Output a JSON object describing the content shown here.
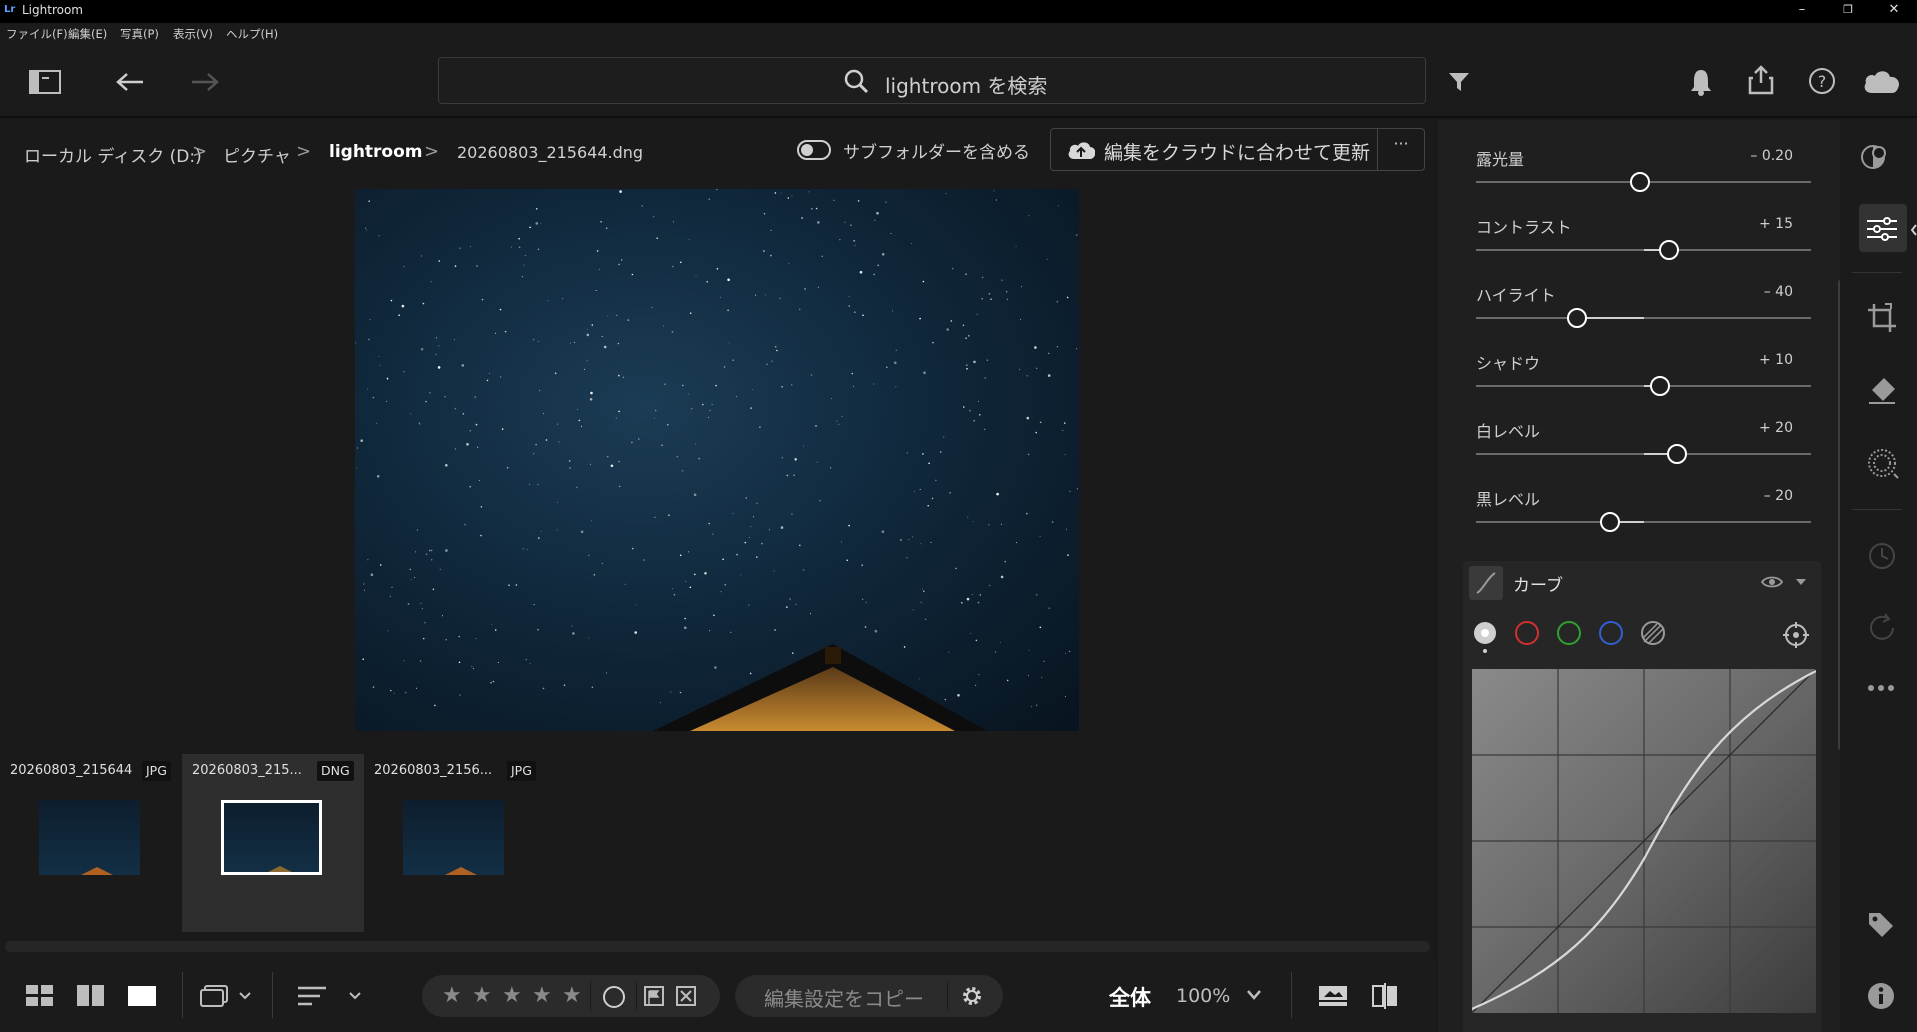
{
  "window": {
    "app_logo": "Lr",
    "title": "Lightroom",
    "minimize": "–",
    "restore": "❐",
    "close": "✕"
  },
  "menu": [
    "ファイル(F)",
    "編集(E)",
    "写真(P)",
    "表示(V)",
    "ヘルプ(H)"
  ],
  "search": {
    "placeholder": "lightroom を検索"
  },
  "breadcrumb": {
    "items": [
      "ローカル ディスク (D:)",
      "ピクチャ",
      "lightroom",
      "20260803_215644.dng"
    ],
    "separator": ">"
  },
  "subfolder_toggle": {
    "label": "サブフォルダーを含める",
    "on": false
  },
  "cloud_button": {
    "label": "編集をクラウドに合わせて更新",
    "more": "···"
  },
  "filmstrip": [
    {
      "name": "20260803_215644",
      "badge": "JPG",
      "selected": false
    },
    {
      "name": "20260803_215...",
      "badge": "DNG",
      "selected": true
    },
    {
      "name": "20260803_2156...",
      "badge": "JPG",
      "selected": false
    }
  ],
  "bottombar": {
    "stars": [
      "★",
      "★",
      "★",
      "★",
      "★"
    ],
    "copy_settings": "編集設定をコピー",
    "view_mode": "全体",
    "zoom": "100%"
  },
  "adjustments": [
    {
      "label": "露光量",
      "value": "– 0.20",
      "norm": 0.49
    },
    {
      "label": "コントラスト",
      "value": "+ 15",
      "norm": 0.575
    },
    {
      "label": "ハイライト",
      "value": "– 40",
      "norm": 0.3
    },
    {
      "label": "シャドウ",
      "value": "+ 10",
      "norm": 0.55
    },
    {
      "label": "白レベル",
      "value": "+ 20",
      "norm": 0.6
    },
    {
      "label": "黒レベル",
      "value": "– 20",
      "norm": 0.4
    }
  ],
  "curve": {
    "title": "カーブ",
    "channels": [
      "point",
      "red",
      "green",
      "blue",
      "parametric"
    ]
  },
  "colors": {
    "accent_white": "#ffffff",
    "red_channel": "#d03030",
    "green_channel": "#30a030",
    "blue_channel": "#3060d0"
  }
}
